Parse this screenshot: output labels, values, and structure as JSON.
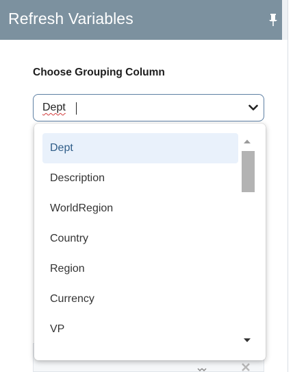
{
  "panel": {
    "title": "Refresh Variables",
    "pin_icon": "pin-icon"
  },
  "grouping": {
    "label": "Choose Grouping Column",
    "value": "Dept",
    "chevron_icon": "chevron-down-icon"
  },
  "dropdown": {
    "options": [
      {
        "label": "Dept",
        "selected": true
      },
      {
        "label": "Description",
        "selected": false
      },
      {
        "label": "WorldRegion",
        "selected": false
      },
      {
        "label": "Country",
        "selected": false
      },
      {
        "label": "Region",
        "selected": false
      },
      {
        "label": "Currency",
        "selected": false
      },
      {
        "label": "VP",
        "selected": false
      }
    ]
  },
  "colors": {
    "title_bar": "#7c919f",
    "selected_bg": "#e9f1fb",
    "selected_text": "#2f5d88",
    "combo_border": "#5d7fa3"
  }
}
